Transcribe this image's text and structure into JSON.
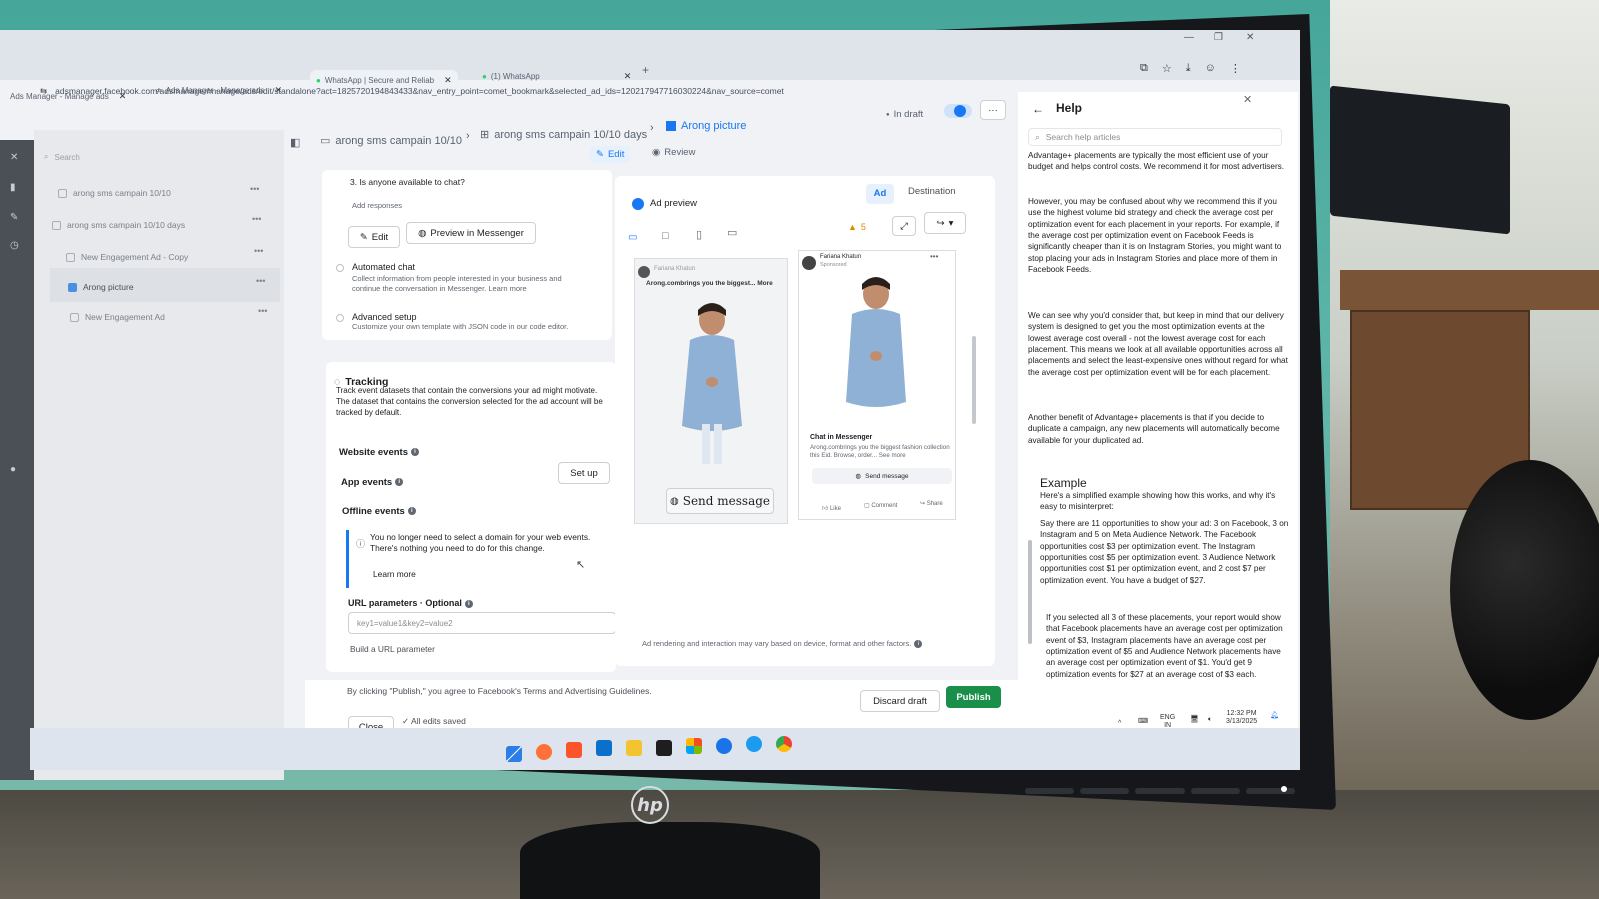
{
  "browser": {
    "tabs": [
      {
        "label": "Ads Manager - Manage ads"
      },
      {
        "label": "Ads Manager - Manage ads"
      },
      {
        "label": "WhatsApp | Secure and Reliab"
      },
      {
        "label": "(1) WhatsApp"
      }
    ],
    "new_tab": "+",
    "url": "adsmanager.facebook.com/adsmanager/manage/ads/edit/standalone?act=1825720194843433&nav_entry_point=comet_bookmark&selected_ad_ids=120217947716030224&nav_source=comet"
  },
  "sidebar": {
    "search_placeholder": "Search",
    "items": [
      {
        "label": "arong sms campain 10/10"
      },
      {
        "label": "arong sms campain 10/10 days"
      },
      {
        "label": "New Engagement Ad - Copy"
      },
      {
        "label": "Arong picture"
      },
      {
        "label": "New Engagement Ad"
      }
    ]
  },
  "breadcrumb": {
    "campaign": "arong sms campain 10/10",
    "adset": "arong sms campain 10/10 days",
    "ad": "Arong picture"
  },
  "mode": {
    "edit": "Edit",
    "review": "Review"
  },
  "status": {
    "draft": "In draft",
    "more": "···"
  },
  "editor": {
    "question": "3. Is anyone available to chat?",
    "add_responses": "Add responses",
    "edit_button": "Edit",
    "preview_messenger": "Preview in Messenger",
    "automated_chat_title": "Automated chat",
    "automated_chat_desc": "Collect information from people interested in your business and continue the conversation in Messenger. Learn more",
    "advanced_title": "Advanced setup",
    "advanced_desc": "Customize your own template with JSON code in our code editor.",
    "tracking_title": "Tracking",
    "tracking_desc": "Track event datasets that contain the conversions your ad might motivate. The dataset that contains the conversion selected for the ad account will be tracked by default.",
    "website_events": "Website events",
    "app_events": "App events",
    "setup_button": "Set up",
    "offline_events": "Offline events",
    "domain_notice": "You no longer need to select a domain for your web events. There's nothing you need to do for this change.",
    "learn_more": "Learn more",
    "url_params_label": "URL parameters · Optional",
    "url_params_placeholder": "key1=value1&key2=value2",
    "build_url": "Build a URL parameter"
  },
  "preview": {
    "title": "Ad preview",
    "tab_ad": "Ad",
    "tab_destination": "Destination",
    "warning_count": "5",
    "story_page": "Fariana Khatun",
    "story_caption": "Arong.combrings you the biggest... More",
    "story_cta": "Send message",
    "feed_page": "Fariana Khatun",
    "feed_sponsored": "Sponsored",
    "feed_headline": "Chat in Messenger",
    "feed_body": "Arong.combrings you the biggest fashion collection this Eid. Browse, order... See more",
    "feed_cta": "Send message",
    "like": "Like",
    "comment": "Comment",
    "share": "Share",
    "disclaimer": "Ad rendering and interaction may vary based on device, format and other factors."
  },
  "help": {
    "title": "Help",
    "search_placeholder": "Search help articles",
    "p1": "Advantage+ placements are typically the most efficient use of your budget and helps control costs. We recommend it for most advertisers.",
    "p2": "However, you may be confused about why we recommend this if you use the highest volume bid strategy and check the average cost per optimization event for each placement in your reports. For example, if the average cost per optimization event on Facebook Feeds is significantly cheaper than it is on Instagram Stories, you might want to stop placing your ads in Instagram Stories and place more of them in Facebook Feeds.",
    "p3": "We can see why you'd consider that, but keep in mind that our delivery system is designed to get you the most optimization events at the lowest average cost overall - not the lowest average cost for each placement. This means we look at all available opportunities across all placements and select the least-expensive ones without regard for what the average cost per optimization event will be for each placement.",
    "p4": "Another benefit of Advantage+ placements is that if you decide to duplicate a campaign, any new placements will automatically become available for your duplicated ad.",
    "example_heading": "Example",
    "p5": "Here's a simplified example showing how this works, and why it's easy to misinterpret:",
    "p6": "Say there are 11 opportunities to show your ad: 3 on Facebook, 3 on Instagram and 5 on Meta Audience Network. The Facebook opportunities cost $3 per optimization event. The Instagram opportunities cost $5 per optimization event. 3 Audience Network opportunities cost $1 per optimization event, and 2 cost $7 per optimization event. You have a budget of $27.",
    "p7": "If you selected all 3 of these placements, your report would show that Facebook placements have an average cost per optimization event of $3, Instagram placements have an average cost per optimization event of $5 and Audience Network placements have an average cost per optimization event of $1. You'd get 9 optimization events for $27 at an average cost of $3 each."
  },
  "footer": {
    "terms": "By clicking \"Publish,\" you agree to Facebook's Terms and Advertising Guidelines.",
    "close": "Close",
    "saved": "All edits saved",
    "discard": "Discard draft",
    "publish": "Publish"
  },
  "taskbar": {
    "lang": "ENG",
    "region": "IN",
    "time": "12:32 PM",
    "date": "3/13/2025"
  },
  "monitor": {
    "brand": "hp"
  },
  "colors": {
    "accent": "#1877f2",
    "publish": "#1a8f4a",
    "screen_bg": "#f0f2f5"
  }
}
